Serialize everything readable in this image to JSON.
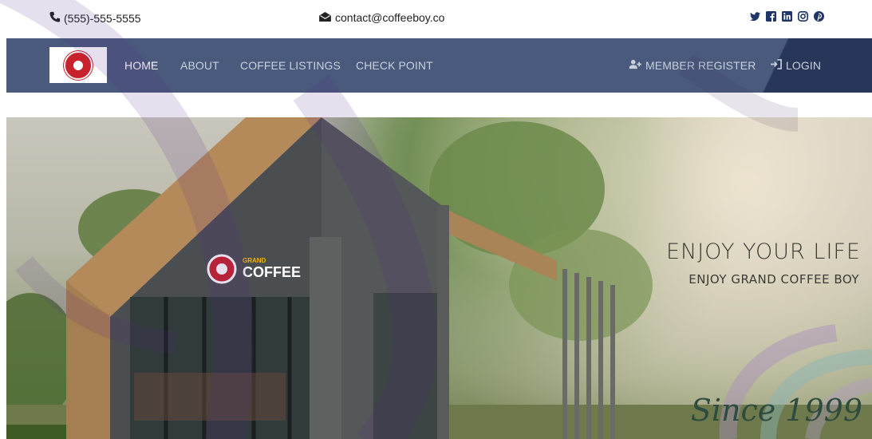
{
  "topbar": {
    "phone": "(555)-555-5555",
    "email": "contact@coffeeboy.co",
    "social_icons": [
      "twitter-icon",
      "facebook-icon",
      "linkedin-icon",
      "instagram-icon",
      "pinterest-icon"
    ]
  },
  "nav": {
    "logo_alt": "Grand Coffee Boy",
    "items": [
      {
        "label": "HOME",
        "active": true
      },
      {
        "label": "ABOUT",
        "active": false
      },
      {
        "label": "COFFEE LISTINGS",
        "active": false
      },
      {
        "label": "CHECK POINT",
        "active": false
      }
    ],
    "register_label": "MEMBER REGISTER",
    "login_label": "LOGIN"
  },
  "hero": {
    "title": "ENJOY YOUR LIFE",
    "subtitle": "ENJOY GRAND COFFEE BOY",
    "since": "Since 1999",
    "sign_small": "GRAND",
    "sign_big": "COFFEE"
  },
  "colors": {
    "nav_bg": "#4a5a7c",
    "nav_active": "#ffffff",
    "nav_text": "#c9d0dc",
    "watermark": "#5a2a8a"
  }
}
